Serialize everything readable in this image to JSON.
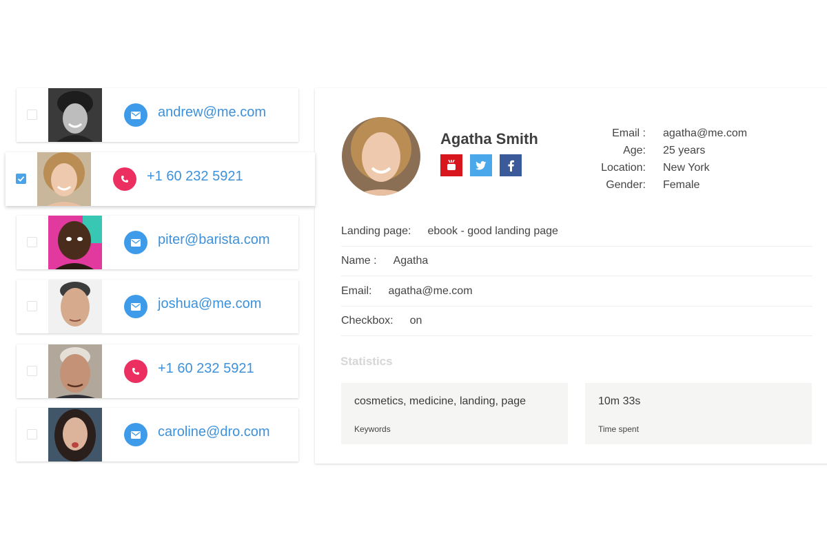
{
  "contacts": [
    {
      "type": "email",
      "value": "andrew@me.com",
      "icon": "envelope-icon",
      "checked": false
    },
    {
      "type": "phone",
      "value": "+1  60 232 5921",
      "icon": "phone-icon",
      "checked": true
    },
    {
      "type": "email",
      "value": "piter@barista.com",
      "icon": "envelope-icon",
      "checked": false
    },
    {
      "type": "email",
      "value": "joshua@me.com",
      "icon": "envelope-icon",
      "checked": false
    },
    {
      "type": "phone",
      "value": "+1  60 232 5921",
      "icon": "phone-icon",
      "checked": false
    },
    {
      "type": "email",
      "value": "caroline@dro.com",
      "icon": "envelope-icon",
      "checked": false
    }
  ],
  "profile": {
    "name": "Agatha Smith",
    "social": [
      "youtube-icon",
      "twitter-icon",
      "facebook-icon"
    ],
    "info": [
      {
        "label": "Email :",
        "value": "agatha@me.com"
      },
      {
        "label": "Age:",
        "value": "25 years"
      },
      {
        "label": "Location:",
        "value": "New York"
      },
      {
        "label": "Gender:",
        "value": "Female"
      }
    ]
  },
  "fields": [
    {
      "label": "Landing page:",
      "value": "ebook - good landing page"
    },
    {
      "label": "Name :",
      "value": "Agatha"
    },
    {
      "label": "Email:",
      "value": "agatha@me.com"
    },
    {
      "label": "Checkbox:",
      "value": "on"
    }
  ],
  "statistics": {
    "title": "Statistics",
    "keywords": {
      "value": "cosmetics, medicine, landing, page",
      "label": "Keywords"
    },
    "time_spent": {
      "value": "10m 33s",
      "label": "Time spent"
    }
  },
  "colors": {
    "accent_blue": "#3d9be9",
    "phone_pink": "#ec2f61",
    "link_text": "#3d91db",
    "youtube_red": "#d8161d",
    "twitter_blue": "#4aa7ea",
    "facebook_blue": "#3b5a9a"
  }
}
